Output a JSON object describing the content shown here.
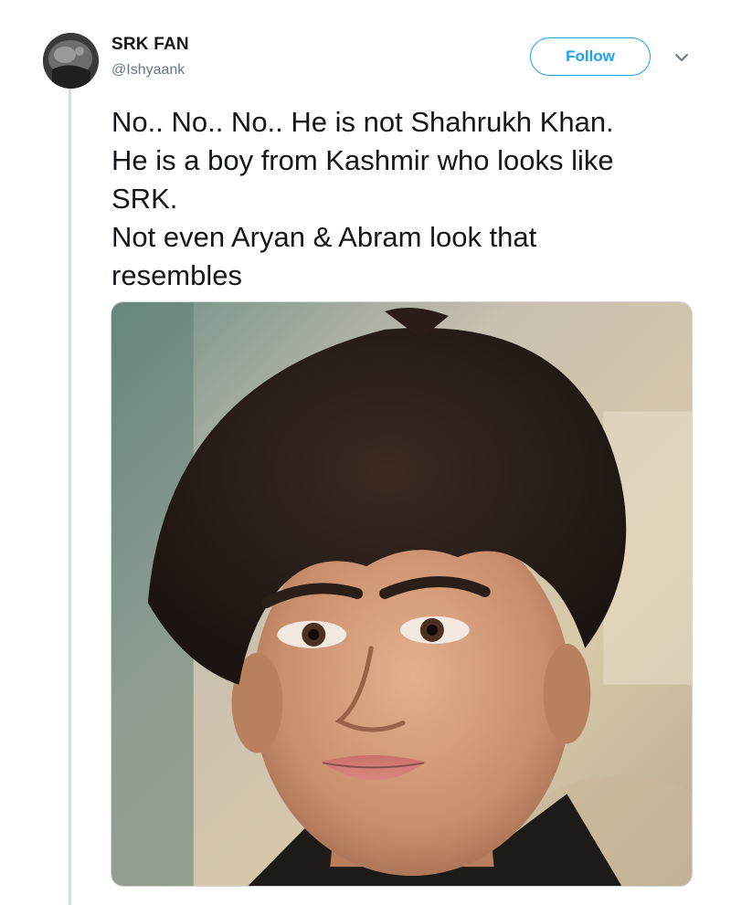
{
  "tweet": {
    "user": {
      "display_name": "SRK FAN",
      "handle": "@Ishyaank"
    },
    "follow_label": "Follow",
    "text_lines": [
      "No.. No.. No.. He is not Shahrukh Khan.",
      "He is a boy from Kashmir who looks like",
      "SRK.",
      "Not even Aryan & Abram look that",
      "resembles"
    ],
    "media": {
      "type": "photo",
      "subject": "portrait of a young boy with dark hair"
    }
  },
  "icons": {
    "menu": "chevron-down-icon",
    "avatar": "avatar-icon"
  },
  "colors": {
    "accent": "#1da1f2",
    "text": "#14171a",
    "secondary_text": "#657786",
    "thread_line": "#c4e0f5"
  }
}
